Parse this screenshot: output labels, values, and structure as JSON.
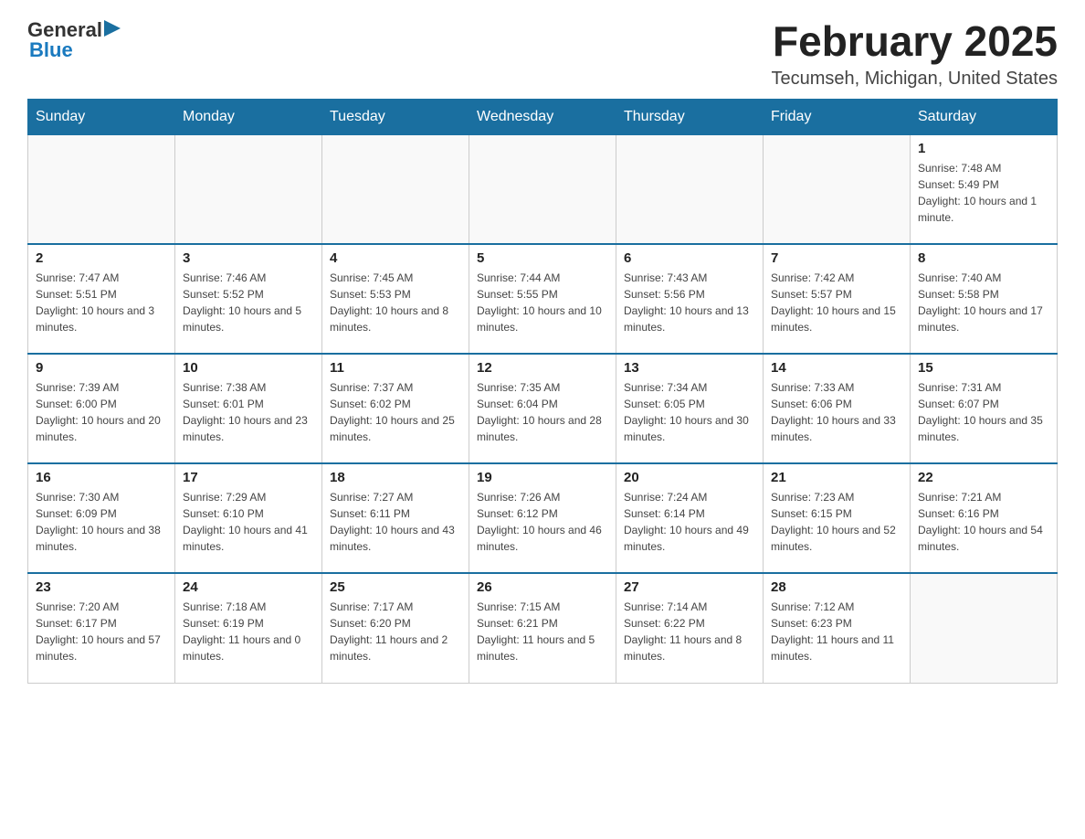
{
  "header": {
    "logo_general": "General",
    "logo_blue": "Blue",
    "month_title": "February 2025",
    "location": "Tecumseh, Michigan, United States"
  },
  "days_of_week": [
    "Sunday",
    "Monday",
    "Tuesday",
    "Wednesday",
    "Thursday",
    "Friday",
    "Saturday"
  ],
  "weeks": [
    [
      {
        "day": "",
        "info": ""
      },
      {
        "day": "",
        "info": ""
      },
      {
        "day": "",
        "info": ""
      },
      {
        "day": "",
        "info": ""
      },
      {
        "day": "",
        "info": ""
      },
      {
        "day": "",
        "info": ""
      },
      {
        "day": "1",
        "info": "Sunrise: 7:48 AM\nSunset: 5:49 PM\nDaylight: 10 hours and 1 minute."
      }
    ],
    [
      {
        "day": "2",
        "info": "Sunrise: 7:47 AM\nSunset: 5:51 PM\nDaylight: 10 hours and 3 minutes."
      },
      {
        "day": "3",
        "info": "Sunrise: 7:46 AM\nSunset: 5:52 PM\nDaylight: 10 hours and 5 minutes."
      },
      {
        "day": "4",
        "info": "Sunrise: 7:45 AM\nSunset: 5:53 PM\nDaylight: 10 hours and 8 minutes."
      },
      {
        "day": "5",
        "info": "Sunrise: 7:44 AM\nSunset: 5:55 PM\nDaylight: 10 hours and 10 minutes."
      },
      {
        "day": "6",
        "info": "Sunrise: 7:43 AM\nSunset: 5:56 PM\nDaylight: 10 hours and 13 minutes."
      },
      {
        "day": "7",
        "info": "Sunrise: 7:42 AM\nSunset: 5:57 PM\nDaylight: 10 hours and 15 minutes."
      },
      {
        "day": "8",
        "info": "Sunrise: 7:40 AM\nSunset: 5:58 PM\nDaylight: 10 hours and 17 minutes."
      }
    ],
    [
      {
        "day": "9",
        "info": "Sunrise: 7:39 AM\nSunset: 6:00 PM\nDaylight: 10 hours and 20 minutes."
      },
      {
        "day": "10",
        "info": "Sunrise: 7:38 AM\nSunset: 6:01 PM\nDaylight: 10 hours and 23 minutes."
      },
      {
        "day": "11",
        "info": "Sunrise: 7:37 AM\nSunset: 6:02 PM\nDaylight: 10 hours and 25 minutes."
      },
      {
        "day": "12",
        "info": "Sunrise: 7:35 AM\nSunset: 6:04 PM\nDaylight: 10 hours and 28 minutes."
      },
      {
        "day": "13",
        "info": "Sunrise: 7:34 AM\nSunset: 6:05 PM\nDaylight: 10 hours and 30 minutes."
      },
      {
        "day": "14",
        "info": "Sunrise: 7:33 AM\nSunset: 6:06 PM\nDaylight: 10 hours and 33 minutes."
      },
      {
        "day": "15",
        "info": "Sunrise: 7:31 AM\nSunset: 6:07 PM\nDaylight: 10 hours and 35 minutes."
      }
    ],
    [
      {
        "day": "16",
        "info": "Sunrise: 7:30 AM\nSunset: 6:09 PM\nDaylight: 10 hours and 38 minutes."
      },
      {
        "day": "17",
        "info": "Sunrise: 7:29 AM\nSunset: 6:10 PM\nDaylight: 10 hours and 41 minutes."
      },
      {
        "day": "18",
        "info": "Sunrise: 7:27 AM\nSunset: 6:11 PM\nDaylight: 10 hours and 43 minutes."
      },
      {
        "day": "19",
        "info": "Sunrise: 7:26 AM\nSunset: 6:12 PM\nDaylight: 10 hours and 46 minutes."
      },
      {
        "day": "20",
        "info": "Sunrise: 7:24 AM\nSunset: 6:14 PM\nDaylight: 10 hours and 49 minutes."
      },
      {
        "day": "21",
        "info": "Sunrise: 7:23 AM\nSunset: 6:15 PM\nDaylight: 10 hours and 52 minutes."
      },
      {
        "day": "22",
        "info": "Sunrise: 7:21 AM\nSunset: 6:16 PM\nDaylight: 10 hours and 54 minutes."
      }
    ],
    [
      {
        "day": "23",
        "info": "Sunrise: 7:20 AM\nSunset: 6:17 PM\nDaylight: 10 hours and 57 minutes."
      },
      {
        "day": "24",
        "info": "Sunrise: 7:18 AM\nSunset: 6:19 PM\nDaylight: 11 hours and 0 minutes."
      },
      {
        "day": "25",
        "info": "Sunrise: 7:17 AM\nSunset: 6:20 PM\nDaylight: 11 hours and 2 minutes."
      },
      {
        "day": "26",
        "info": "Sunrise: 7:15 AM\nSunset: 6:21 PM\nDaylight: 11 hours and 5 minutes."
      },
      {
        "day": "27",
        "info": "Sunrise: 7:14 AM\nSunset: 6:22 PM\nDaylight: 11 hours and 8 minutes."
      },
      {
        "day": "28",
        "info": "Sunrise: 7:12 AM\nSunset: 6:23 PM\nDaylight: 11 hours and 11 minutes."
      },
      {
        "day": "",
        "info": ""
      }
    ]
  ]
}
